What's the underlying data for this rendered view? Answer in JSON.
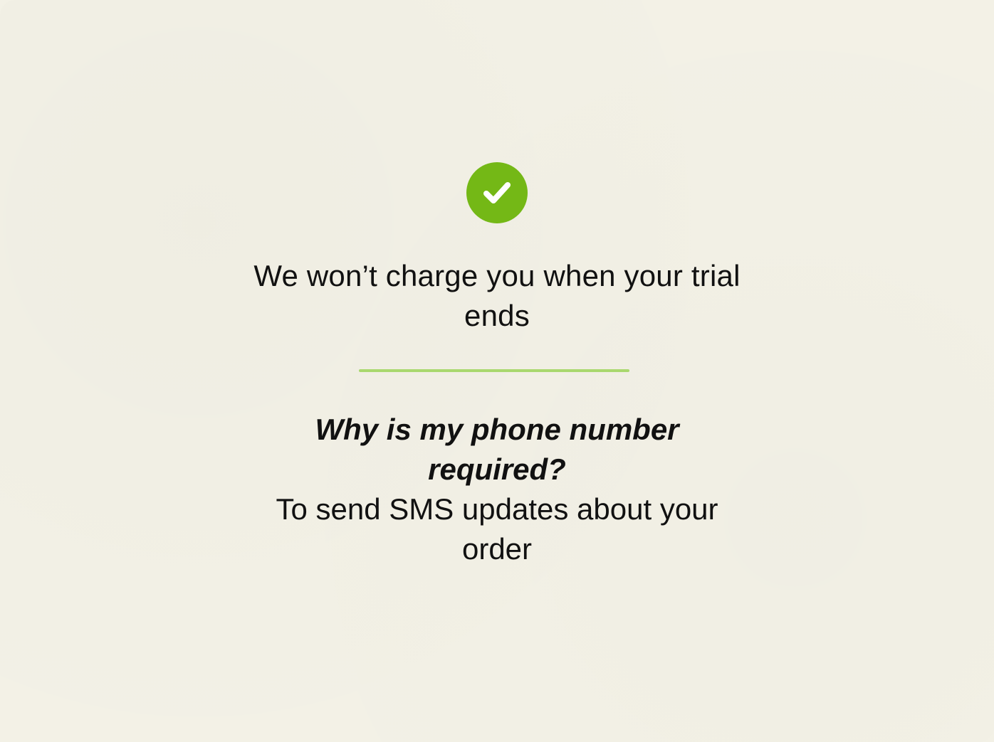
{
  "confirmation": {
    "icon": "check-circle-icon",
    "icon_color": "#74b816",
    "headline": "We won’t charge you when your trial ends"
  },
  "divider_color": "#a9d86e",
  "faq": {
    "question": "Why is my phone number required?",
    "answer": "To send SMS updates about your order"
  },
  "colors": {
    "background": "#f3f1e6",
    "text": "#111111"
  }
}
